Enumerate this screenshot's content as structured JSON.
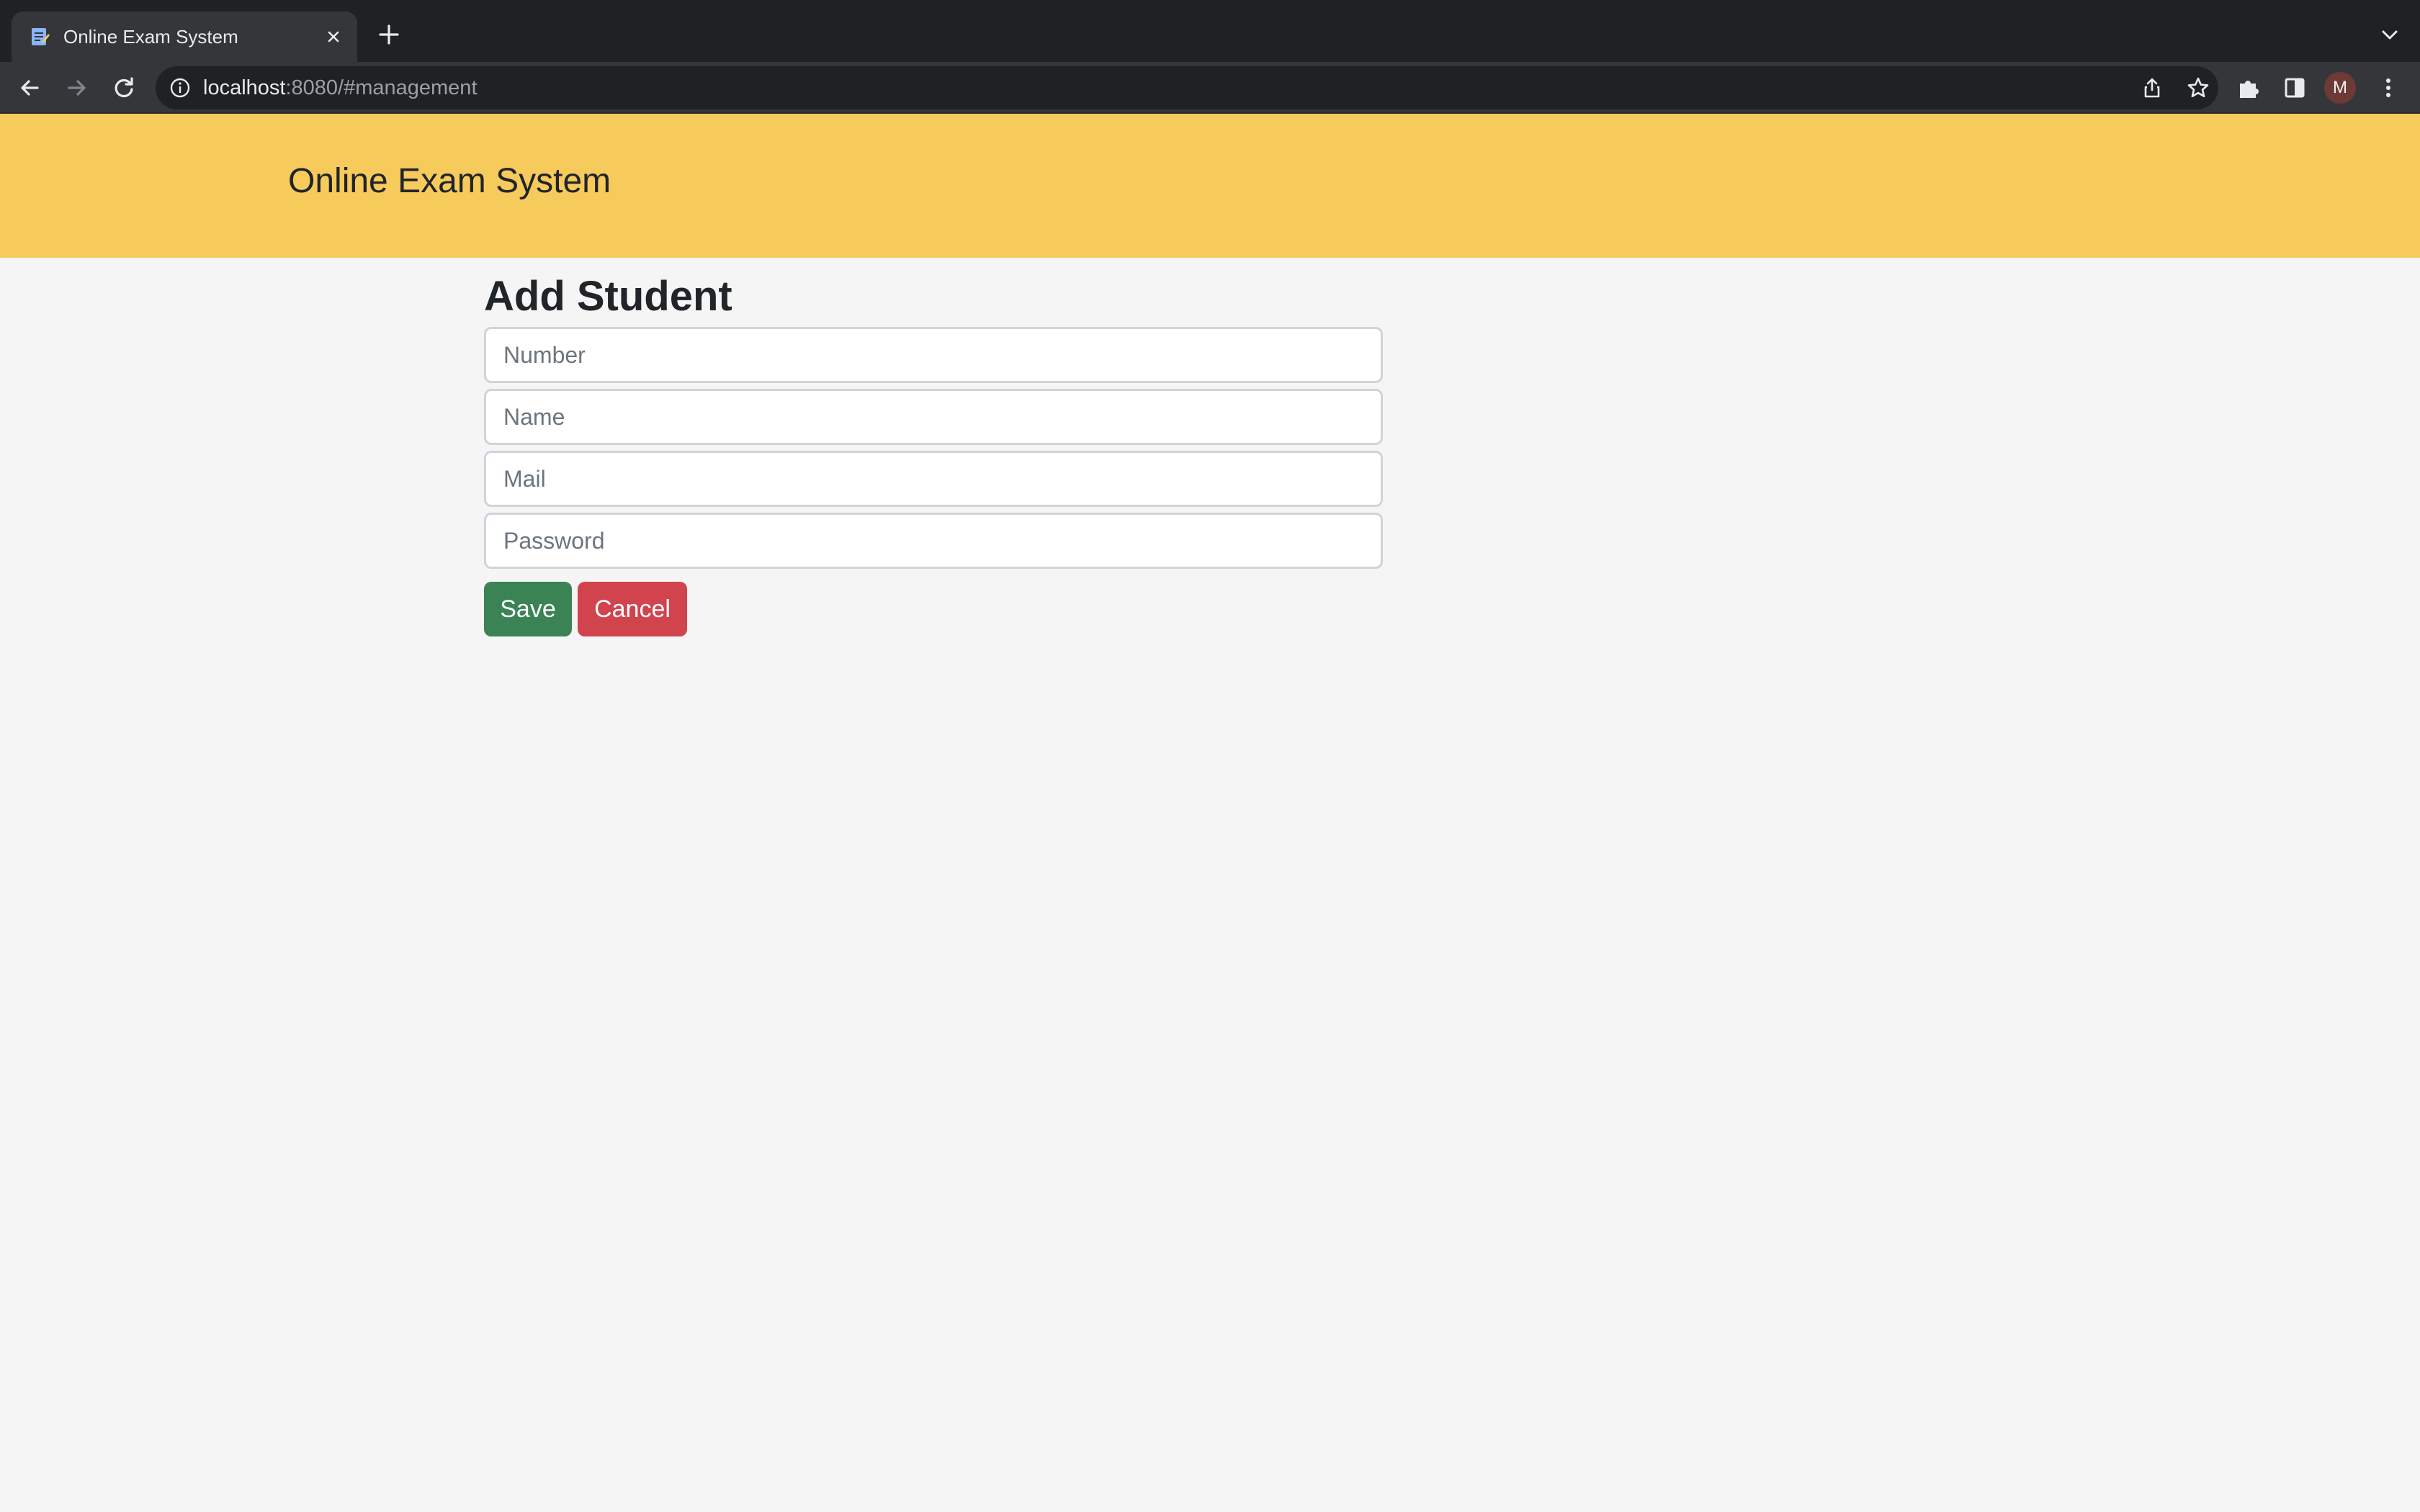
{
  "browser": {
    "tab_title": "Online Exam System",
    "url_host": "localhost",
    "url_rest": ":8080/#management",
    "profile_initial": "M",
    "icons": {
      "favicon": "page-favicon-icon",
      "tab_close": "close-icon",
      "new_tab": "plus-icon",
      "tab_list": "chevron-down-icon",
      "back": "arrow-left-icon",
      "forward": "arrow-right-icon",
      "reload": "reload-icon",
      "site_info": "info-icon",
      "share": "share-icon",
      "bookmark": "star-icon",
      "extensions": "puzzle-icon",
      "side_panel": "side-panel-icon",
      "menu": "kebab-menu-icon"
    }
  },
  "header": {
    "brand": "Online Exam System"
  },
  "form": {
    "title": "Add Student",
    "fields": {
      "number": {
        "placeholder": "Number",
        "value": ""
      },
      "name": {
        "placeholder": "Name",
        "value": ""
      },
      "mail": {
        "placeholder": "Mail",
        "value": ""
      },
      "password": {
        "placeholder": "Password",
        "value": ""
      }
    },
    "save_label": "Save",
    "cancel_label": "Cancel"
  },
  "colors": {
    "header_bg": "#f7ca5c",
    "save_bg": "#3b8355",
    "cancel_bg": "#d1434d",
    "page_bg": "#f5f5f5"
  }
}
